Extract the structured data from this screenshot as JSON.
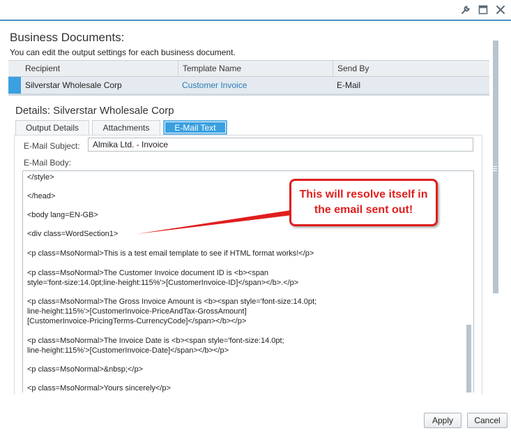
{
  "window": {
    "icons": [
      "wrench-icon",
      "maximize-icon",
      "close-icon"
    ]
  },
  "section": {
    "title": "Business Documents:",
    "subtitle": "You can edit the output settings for each business document."
  },
  "table": {
    "columns": [
      "Recipient",
      "Template Name",
      "Send By"
    ],
    "rows": [
      {
        "recipient": "Silverstar Wholesale Corp",
        "template": "Customer Invoice",
        "send_by": "E-Mail"
      }
    ]
  },
  "details": {
    "title": "Details: Silverstar Wholesale Corp",
    "tabs": [
      "Output Details",
      "Attachments",
      "E-Mail Text"
    ],
    "active_tab": "E-Mail Text"
  },
  "email": {
    "subject_label": "E-Mail Subject:",
    "subject_value": "Almika Ltd. - Invoice",
    "body_label": "E-Mail Body:",
    "body_lines": [
      "</style>",
      "",
      "</head>",
      "",
      "<body lang=EN-GB>",
      "",
      "<div class=WordSection1>",
      "",
      "<p class=MsoNormal>This is a test email template to see if HTML format works!</p>",
      "",
      "<p class=MsoNormal>The Customer Invoice document ID is <b><span",
      "style='font-size:14.0pt;line-height:115%'>[CustomerInvoice-ID]</span></b>.</p>",
      "",
      "<p class=MsoNormal>The Gross Invoice Amount is <b><span style='font-size:14.0pt;",
      "line-height:115%'>[CustomerInvoice-PriceAndTax-GrossAmount]",
      "[CustomerInvoice-PricingTerms-CurrencyCode]</span></b></p>",
      "",
      "<p class=MsoNormal>The Invoice Date is <b><span style='font-size:14.0pt;",
      "line-height:115%'>[CustomerInvoice-Date]</span></b></p>",
      "",
      "<p class=MsoNormal>&nbsp;</p>",
      "",
      "<p class=MsoNormal>Yours sincerely</p>"
    ]
  },
  "annotation": {
    "text": "This will resolve itself in the email sent out!",
    "color": "#e01e1e"
  },
  "buttons": {
    "apply": "Apply",
    "cancel": "Cancel"
  },
  "colors": {
    "accent": "#3aa0e0",
    "link": "#2a7ab8"
  }
}
